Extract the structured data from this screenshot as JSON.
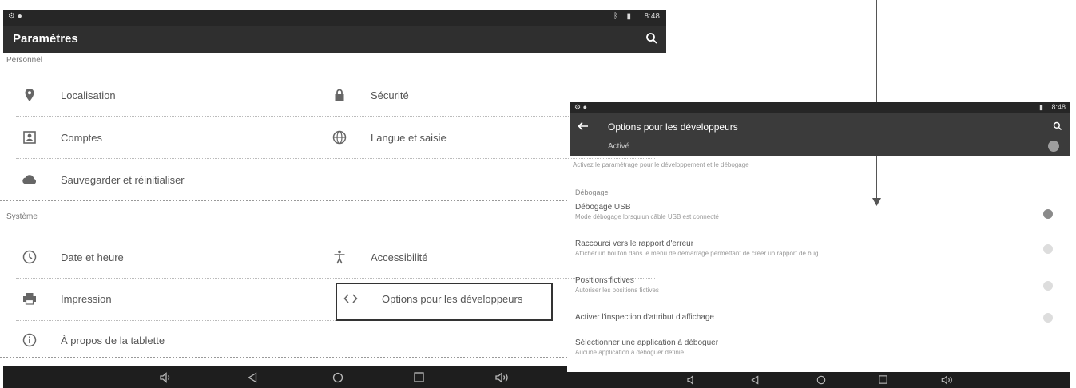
{
  "left": {
    "status": {
      "time": "8:48"
    },
    "appbar": {
      "title": "Paramètres"
    },
    "personal": {
      "heading": "Personnel",
      "items": [
        {
          "label": "Localisation",
          "icon": "location-icon"
        },
        {
          "label": "Sécurité",
          "icon": "lock-icon"
        },
        {
          "label": "Comptes",
          "icon": "account-icon"
        },
        {
          "label": "Langue et saisie",
          "icon": "globe-icon"
        },
        {
          "label": "Sauvegarder et réinitialiser",
          "icon": "backup-icon"
        }
      ]
    },
    "system": {
      "heading": "Système",
      "items": [
        {
          "label": "Date et heure",
          "icon": "clock-icon"
        },
        {
          "label": "Accessibilité",
          "icon": "accessibility-icon"
        },
        {
          "label": "Impression",
          "icon": "printer-icon"
        },
        {
          "label": "Options pour les développeurs",
          "icon": "code-icon"
        },
        {
          "label": "À propos de la tablette",
          "icon": "info-icon"
        }
      ]
    }
  },
  "right": {
    "status": {
      "time": "8:48"
    },
    "appbar": {
      "title": "Options pour les développeurs",
      "active_label": "Activé"
    },
    "header_note": "Activez le paramétrage pour le développement et le débogage",
    "debug_heading": "Débogage",
    "options": [
      {
        "title": "Débogage USB",
        "subtitle": "Mode débogage lorsqu'un câble USB est connecté",
        "on": true
      },
      {
        "title": "Raccourci vers le rapport d'erreur",
        "subtitle": "Afficher un bouton dans le menu de démarrage permettant de créer un rapport de bug",
        "on": false
      },
      {
        "title": "Positions fictives",
        "subtitle": "Autoriser les positions fictives",
        "on": false
      },
      {
        "title": "Activer l'inspection d'attribut d'affichage",
        "subtitle": "",
        "on": false
      },
      {
        "title": "Sélectionner une application à déboguer",
        "subtitle": "Aucune application à déboguer définie",
        "on": null
      }
    ]
  },
  "colors": {
    "statusbar": "#262626",
    "appbar": "#2f2f2f",
    "navbar": "#1e1e1e"
  }
}
